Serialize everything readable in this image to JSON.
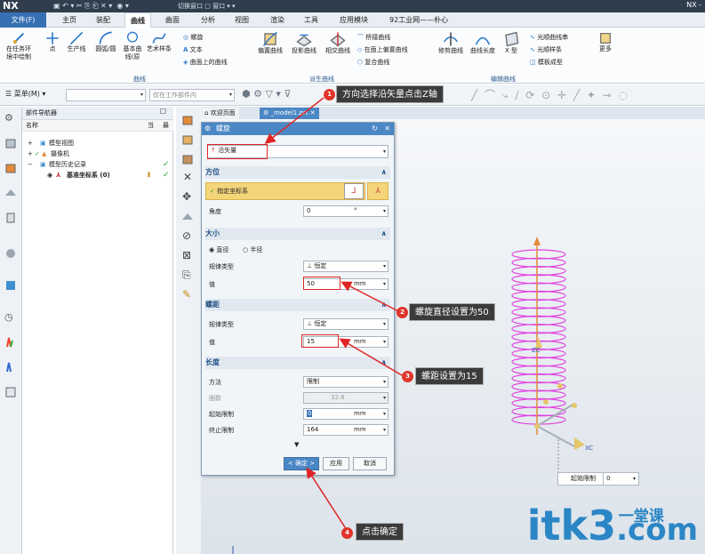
{
  "titlebar": {
    "app": "NX",
    "switch_window": "切换窗口",
    "window": "窗口",
    "right": "NX -"
  },
  "menu": {
    "file": "文件(F)",
    "tabs": [
      "主页",
      "装配",
      "曲线",
      "曲面",
      "分析",
      "视图",
      "渲染",
      "工具",
      "应用模块",
      "92工业网——朴心"
    ],
    "active_index": 2
  },
  "ribbon": {
    "btn_sketch": "在任务环境中绘制",
    "btn_point": "点",
    "btn_production_line": "生产线",
    "btn_arc": "圆弧/圆",
    "btn_base_curve": "基本曲线(原",
    "btn_art_spline": "艺术样条",
    "small1": "螺旋",
    "small2": "文本",
    "small3": "曲面上的曲线",
    "btn_offset": "偏置曲线",
    "btn_project": "投影曲线",
    "btn_intersect": "相交曲线",
    "small4": "桥接曲线",
    "small5": "在面上偏置曲线",
    "small6": "复合曲线",
    "btn_trim": "修剪曲线",
    "btn_length": "曲线长度",
    "btn_x": "X 型",
    "small7": "光顺曲线串",
    "small8": "光顺样条",
    "small9": "模板成型",
    "btn_more": "更多",
    "group_curve": "曲线",
    "group_derived": "派生曲线",
    "group_edit": "编辑曲线"
  },
  "cmdbar": {
    "menu_label": "菜单(M)",
    "filter_placeholder": "仅在工作部件内"
  },
  "navigator": {
    "title": "部件导航器",
    "col_name": "名称",
    "col_current": "当",
    "col_latest": "最",
    "rows": [
      "模型视图",
      "摄像机",
      "模型历史记录",
      "基准坐标系 (0)"
    ]
  },
  "viewtabs": {
    "welcome": "欢迎页面",
    "model": "_model1.prt"
  },
  "dialog": {
    "title": "螺旋",
    "type_value": "沿矢量",
    "sec_orientation": "方位",
    "csys_label": "指定坐标系",
    "angle_label": "角度",
    "angle_value": "0",
    "angle_unit": "°",
    "sec_size": "大小",
    "radio_diameter": "直径",
    "radio_radius": "半径",
    "law_label": "规律类型",
    "law_value": "恒定",
    "value_label": "值",
    "size_value": "50",
    "unit_mm": "mm",
    "sec_pitch": "螺距",
    "pitch_law_label": "规律类型",
    "pitch_law_value": "恒定",
    "pitch_value_label": "值",
    "pitch_value": "15",
    "sec_length": "长度",
    "method_label": "方法",
    "method_value": "限制",
    "turns_label": "圈数",
    "turns_value": "32.8",
    "start_label": "起始限制",
    "start_value": "0",
    "end_label": "终止限制",
    "end_value": "164",
    "ok": "< 确定 >",
    "apply": "应用",
    "cancel": "取消"
  },
  "callouts": [
    {
      "num": "1",
      "text": "方向选择沿矢量点击Z轴"
    },
    {
      "num": "2",
      "text": "螺旋直径设置为50"
    },
    {
      "num": "3",
      "text": "螺距设置为15"
    },
    {
      "num": "4",
      "text": "点击确定"
    }
  ],
  "viewport": {
    "limit_label": "起始限制",
    "limit_value": "0",
    "axis_zc": "ZC",
    "axis_xc": "XC"
  },
  "watermark": {
    "main": "itk3",
    "dotcom": ".com",
    "sub": "一堂课"
  },
  "colors": {
    "helix": "#e040e0",
    "accent": "#4b87c5",
    "callout_red": "#e0352b"
  }
}
